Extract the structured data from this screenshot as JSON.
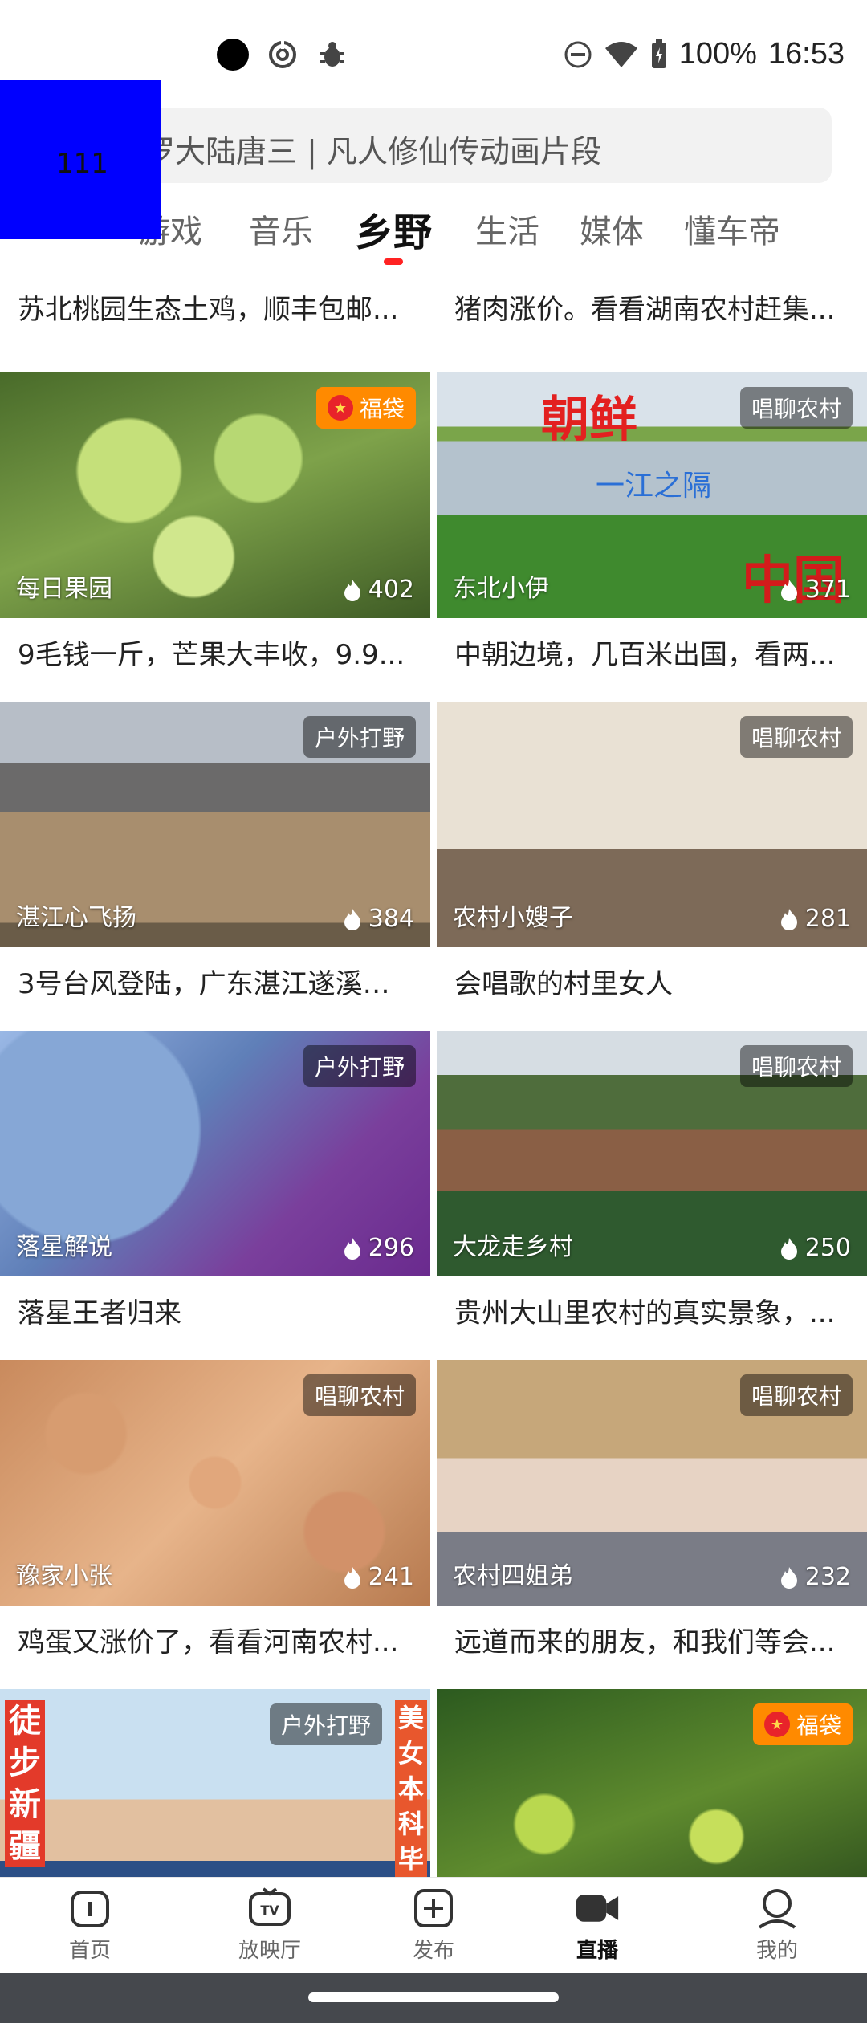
{
  "status_bar": {
    "battery_percent": "100%",
    "time": "16:53"
  },
  "search": {
    "text": "罗大陆唐三 | 凡人修仙传动画片段"
  },
  "overlay_block": {
    "label": "111"
  },
  "tabs": [
    {
      "label": "游戏"
    },
    {
      "label": "音乐"
    },
    {
      "label": "乡野"
    },
    {
      "label": "生活"
    },
    {
      "label": "媒体"
    },
    {
      "label": "懂车帝"
    }
  ],
  "active_tab": "乡野",
  "cards": [
    {
      "title": "苏北桃园生态土鸡，顺丰包邮..."
    },
    {
      "title": "猪肉涨价。看看湖南农村赶集..."
    },
    {
      "author": "每日果园",
      "views": "402",
      "badge": "福袋",
      "title": "9毛钱一斤，芒果大丰收，9.9..."
    },
    {
      "author": "东北小伊",
      "views": "371",
      "badge": "唱聊农村",
      "title": "中朝边境，几百米出国，看两...",
      "overlay_red": "朝鲜",
      "overlay_blue": "一江之隔",
      "overlay_corner": "中国"
    },
    {
      "author": "湛江心飞扬",
      "views": "384",
      "badge": "户外打野",
      "title": "3号台风登陆，广东湛江遂溪第..."
    },
    {
      "author": "农村小嫂子",
      "views": "281",
      "badge": "唱聊农村",
      "title": "会唱歌的村里女人"
    },
    {
      "author": "落星解说",
      "views": "296",
      "badge": "户外打野",
      "title": "落星王者归来"
    },
    {
      "author": "大龙走乡村",
      "views": "250",
      "badge": "唱聊农村",
      "title": "贵州大山里农村的真实景象，..."
    },
    {
      "author": "豫家小张",
      "views": "241",
      "badge": "唱聊农村",
      "title": "鸡蛋又涨价了，看看河南农村..."
    },
    {
      "author": "农村四姐弟",
      "views": "232",
      "badge": "唱聊农村",
      "title": "远道而来的朋友，和我们等会..."
    },
    {
      "badge": "户外打野",
      "overlay_left": "徒步新疆",
      "overlay_right": "美女本科毕"
    },
    {
      "badge": "福袋"
    }
  ],
  "bottom_nav": [
    {
      "label": "首页",
      "icon": "home-icon"
    },
    {
      "label": "放映厅",
      "icon": "tv-icon"
    },
    {
      "label": "发布",
      "icon": "plus-square-icon"
    },
    {
      "label": "直播",
      "icon": "camera-icon"
    },
    {
      "label": "我的",
      "icon": "person-icon"
    }
  ],
  "active_nav": "直播",
  "colors": {
    "accent_red": "#ff2222",
    "fudai_orange": "#ff8a00",
    "overlay_blue": "#0000ff"
  }
}
